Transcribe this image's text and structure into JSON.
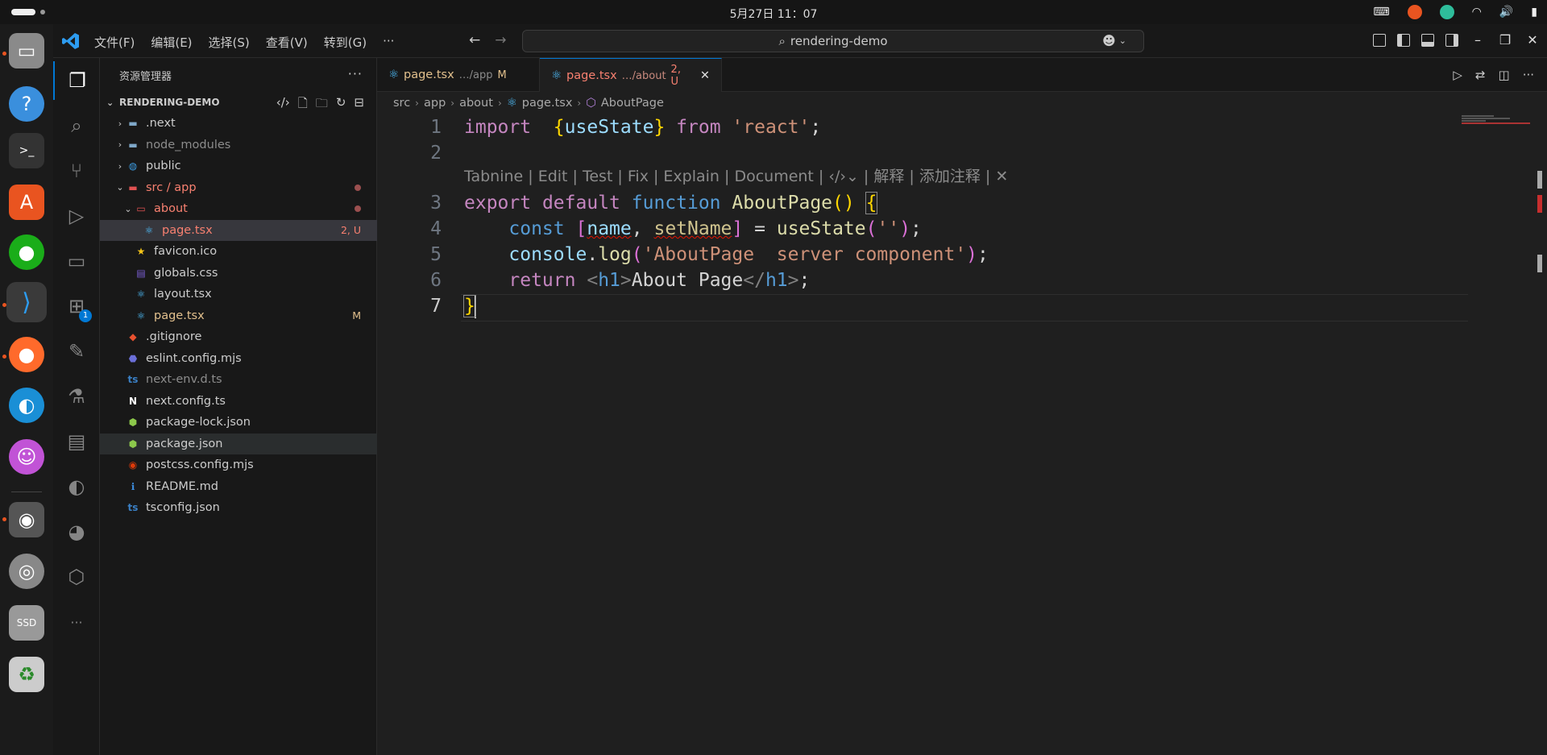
{
  "topbar": {
    "clock": "5月27日 11：07"
  },
  "titlebar": {
    "menus": [
      "文件(F)",
      "编辑(E)",
      "选择(S)",
      "查看(V)",
      "转到(G)",
      "···"
    ],
    "search_text": "rendering-demo",
    "back_arrow": "←",
    "forward_arrow": "→"
  },
  "explorer": {
    "title": "资源管理器",
    "more": "···",
    "section": "RENDERING-DEMO",
    "tree": [
      {
        "label": ".next",
        "kind": "folder-collapsed",
        "depth": 0,
        "icon": "folder-icon",
        "color": "default"
      },
      {
        "label": "node_modules",
        "kind": "folder-collapsed",
        "depth": 0,
        "icon": "folder-icon",
        "color": "gray"
      },
      {
        "label": "public",
        "kind": "folder-collapsed",
        "depth": 0,
        "icon": "globe-folder-icon",
        "color": "default"
      },
      {
        "label": "src / app",
        "kind": "folder-expanded",
        "depth": 0,
        "icon": "folder-icon",
        "color": "red",
        "dot": true
      },
      {
        "label": "about",
        "kind": "folder-expanded",
        "depth": 1,
        "icon": "open-folder-icon",
        "color": "red",
        "dot": true
      },
      {
        "label": "page.tsx",
        "kind": "file",
        "depth": 2,
        "icon": "react-icon",
        "color": "red",
        "status": "2, U",
        "selected": true
      },
      {
        "label": "favicon.ico",
        "kind": "file",
        "depth": 1,
        "icon": "star-icon",
        "color": "default"
      },
      {
        "label": "globals.css",
        "kind": "file",
        "depth": 1,
        "icon": "css-icon",
        "color": "default"
      },
      {
        "label": "layout.tsx",
        "kind": "file",
        "depth": 1,
        "icon": "react-icon",
        "color": "default"
      },
      {
        "label": "page.tsx",
        "kind": "file",
        "depth": 1,
        "icon": "react-icon",
        "color": "yellow",
        "status": "M"
      },
      {
        "label": ".gitignore",
        "kind": "file",
        "depth": 0,
        "icon": "git-icon",
        "color": "default"
      },
      {
        "label": "eslint.config.mjs",
        "kind": "file",
        "depth": 0,
        "icon": "eslint-icon",
        "color": "default"
      },
      {
        "label": "next-env.d.ts",
        "kind": "file",
        "depth": 0,
        "icon": "ts-icon",
        "color": "gray"
      },
      {
        "label": "next.config.ts",
        "kind": "file",
        "depth": 0,
        "icon": "next-icon",
        "color": "default"
      },
      {
        "label": "package-lock.json",
        "kind": "file",
        "depth": 0,
        "icon": "node-icon",
        "color": "default"
      },
      {
        "label": "package.json",
        "kind": "file",
        "depth": 0,
        "icon": "node-icon",
        "color": "default",
        "hover": true
      },
      {
        "label": "postcss.config.mjs",
        "kind": "file",
        "depth": 0,
        "icon": "postcss-icon",
        "color": "default"
      },
      {
        "label": "README.md",
        "kind": "file",
        "depth": 0,
        "icon": "info-icon",
        "color": "default"
      },
      {
        "label": "tsconfig.json",
        "kind": "file",
        "depth": 0,
        "icon": "tsconfig-icon",
        "color": "default"
      }
    ]
  },
  "tabs": [
    {
      "name": "page.tsx",
      "path": "…/app",
      "status": "M"
    },
    {
      "name": "page.tsx",
      "path": "…/about",
      "status": "2, U",
      "close": "✕"
    }
  ],
  "breadcrumb": [
    "src",
    "app",
    "about",
    "page.tsx",
    "AboutPage"
  ],
  "editor": {
    "line_numbers": [
      "1",
      "2",
      "3",
      "4",
      "5",
      "6",
      "7"
    ],
    "codelens": "Tabnine | Edit | Test | Fix | Explain | Document | ‹/›⌄ | 解释 | 添加注释 | ✕",
    "line1": {
      "import": "import",
      "brace_open": "{",
      "ident": "useState",
      "brace_close": "}",
      "from": "from",
      "mod": "'react'",
      "semi": ";"
    },
    "line3": {
      "export": "export",
      "default": "default",
      "function": "function",
      "name": "AboutPage",
      "paren": "()",
      "brace": "{"
    },
    "line4": {
      "const": "const",
      "lbr": "[",
      "v1": "name",
      "comma": ",",
      "v2": "setName",
      "rbr": "]",
      "eq": "=",
      "call": "useState",
      "lp": "(",
      "arg": "''",
      "rp": ")",
      "semi": ";"
    },
    "line5": {
      "obj": "console",
      "dot": ".",
      "fn": "log",
      "lp": "(",
      "arg": "'AboutPage  server component'",
      "rp": ")",
      "semi": ";"
    },
    "line6": {
      "ret": "return",
      "lt": "<",
      "tag": "h1",
      "gt": ">",
      "text": "About Page",
      "lt2": "</",
      "tag2": "h1",
      "gt2": ">",
      "semi": ";"
    },
    "line7": {
      "brace": "}"
    }
  }
}
